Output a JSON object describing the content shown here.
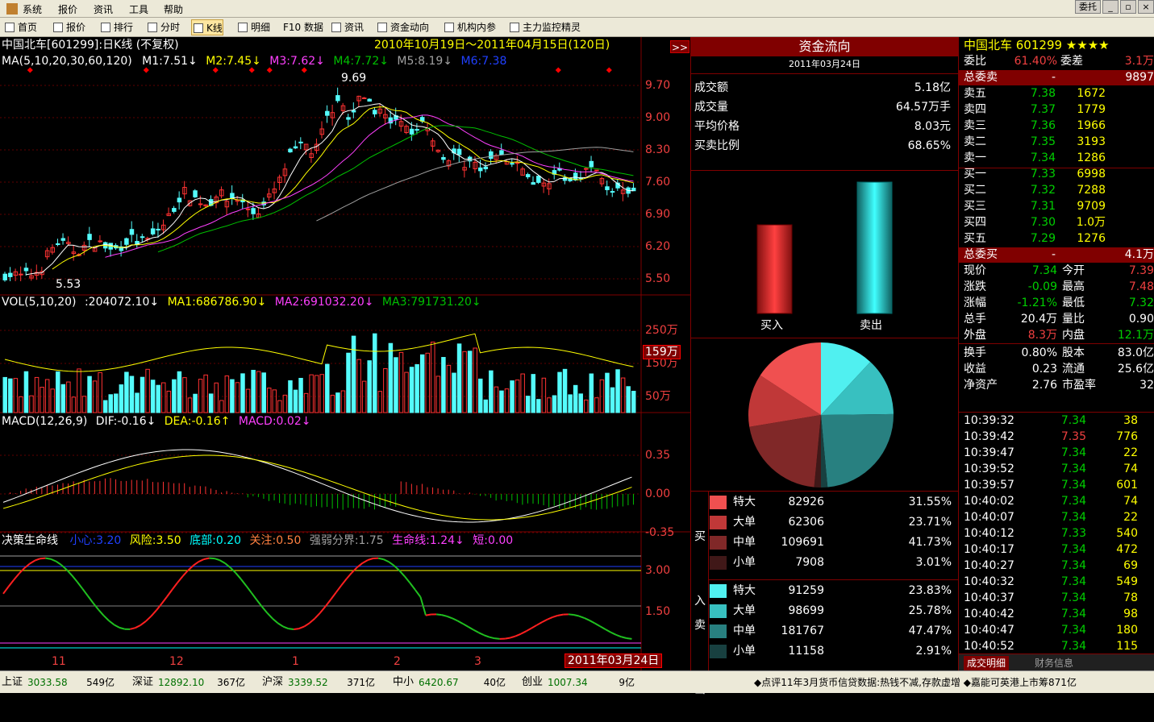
{
  "menu": [
    "系统",
    "报价",
    "资讯",
    "工具",
    "帮助"
  ],
  "window": {
    "right_tab": "委托"
  },
  "toolbar": [
    {
      "label": "首页"
    },
    {
      "label": "报价"
    },
    {
      "label": "排行"
    },
    {
      "label": "分时"
    },
    {
      "label": "K线"
    },
    {
      "label": "明细"
    },
    {
      "label": "F10 数据"
    },
    {
      "label": "资讯"
    },
    {
      "label": "资金动向"
    },
    {
      "label": "机构内参"
    },
    {
      "label": "主力监控精灵"
    }
  ],
  "chart": {
    "title": "中国北车[601299]:日K线",
    "adjust": "(不复权)",
    "date_range": "2010年10月19日～2011年04月15日(120日)",
    "expand_btn": ">>",
    "ma": {
      "label": "MA(5,10,20,30,60,120)",
      "m1": "M1:7.51↓",
      "m2": "M2:7.45↓",
      "m3": "M3:7.62↓",
      "m4": "M4:7.72↓",
      "m5": "M5:8.19↓",
      "m6": "M6:7.38"
    },
    "price_axis": [
      "9.70",
      "9.00",
      "8.30",
      "7.60",
      "6.90",
      "6.20",
      "5.50"
    ],
    "high_label": "9.69",
    "low_label": "5.53",
    "vol": {
      "label": "VOL(5,10,20)",
      "v": ":204072.10↓",
      "ma1": "MA1:686786.90↓",
      "ma2": "MA2:691032.20↓",
      "ma3": "MA3:791731.20↓"
    },
    "vol_axis": [
      "250万",
      "150万",
      "50万"
    ],
    "vol_marker": "159万",
    "macd": {
      "label": "MACD(12,26,9)",
      "dif": "DIF:-0.16↓",
      "dea": "DEA:-0.16↑",
      "macd": "MACD:0.02↓"
    },
    "macd_axis": [
      "0.35",
      "0.00",
      "-0.35"
    ],
    "jc": {
      "label": "决策生命线",
      "xin": "小心:3.20",
      "fx": "风险:3.50",
      "db": "底部:0.20",
      "gz": "关注:0.50",
      "qr": "强弱分界:1.75",
      "smx": "生命线:1.24↓",
      "duan": "短:0.00"
    },
    "jc_axis": [
      "3.00",
      "1.50"
    ],
    "x_labels": [
      "11",
      "12",
      "1",
      "2",
      "3"
    ],
    "cursor_date": "2011年03月24日"
  },
  "fund": {
    "title": "资金流向",
    "date": "2011年03月24日",
    "rows": [
      {
        "k": "成交额",
        "v": "5.18亿"
      },
      {
        "k": "成交量",
        "v": "64.57万手"
      },
      {
        "k": "平均价格",
        "v": "8.03元"
      },
      {
        "k": "买卖比例",
        "v": "68.65%"
      }
    ],
    "buy_label": "买入",
    "sell_label": "卖出",
    "buy_side": "买入",
    "sell_side": "卖出",
    "buy_rows": [
      {
        "k": "特大",
        "n": "82926",
        "p": "31.55%",
        "c": "#f05050"
      },
      {
        "k": "大单",
        "n": "62306",
        "p": "23.71%",
        "c": "#c03838"
      },
      {
        "k": "中单",
        "n": "109691",
        "p": "41.73%",
        "c": "#802828"
      },
      {
        "k": "小单",
        "n": "7908",
        "p": "3.01%",
        "c": "#401818"
      }
    ],
    "sell_rows": [
      {
        "k": "特大",
        "n": "91259",
        "p": "23.83%",
        "c": "#50f0f0"
      },
      {
        "k": "大单",
        "n": "98699",
        "p": "25.78%",
        "c": "#38c0c0"
      },
      {
        "k": "中单",
        "n": "181767",
        "p": "47.47%",
        "c": "#288080"
      },
      {
        "k": "小单",
        "n": "11158",
        "p": "2.91%",
        "c": "#184040"
      }
    ]
  },
  "quote": {
    "name": "中国北车 601299",
    "stars": "★★★★",
    "wb": "委比",
    "wb_v": "61.40%",
    "wc": "委差",
    "wc_v": "3.1万",
    "zwm": "总委卖",
    "zwm_v": "-",
    "zwm_n": "9897",
    "asks": [
      {
        "k": "卖五",
        "p": "7.38",
        "n": "1672"
      },
      {
        "k": "卖四",
        "p": "7.37",
        "n": "1779"
      },
      {
        "k": "卖三",
        "p": "7.36",
        "n": "1966"
      },
      {
        "k": "卖二",
        "p": "7.35",
        "n": "3193"
      },
      {
        "k": "卖一",
        "p": "7.34",
        "n": "1286"
      }
    ],
    "bids": [
      {
        "k": "买一",
        "p": "7.33",
        "n": "6998"
      },
      {
        "k": "买二",
        "p": "7.32",
        "n": "7288"
      },
      {
        "k": "买三",
        "p": "7.31",
        "n": "9709"
      },
      {
        "k": "买四",
        "p": "7.30",
        "n": "1.0万"
      },
      {
        "k": "买五",
        "p": "7.29",
        "n": "1276"
      }
    ],
    "zwb": "总委买",
    "zwb_v": "-",
    "zwb_n": "4.1万",
    "stats": [
      {
        "a": "现价",
        "av": "7.34",
        "b": "今开",
        "bv": "7.39",
        "ac": "#00d000",
        "bc": "#f04040"
      },
      {
        "a": "涨跌",
        "av": "-0.09",
        "b": "最高",
        "bv": "7.48",
        "ac": "#00d000",
        "bc": "#f04040"
      },
      {
        "a": "涨幅",
        "av": "-1.21%",
        "b": "最低",
        "bv": "7.32",
        "ac": "#00d000",
        "bc": "#00d000"
      },
      {
        "a": "总手",
        "av": "20.4万",
        "b": "量比",
        "bv": "0.90",
        "ac": "#fff",
        "bc": "#fff"
      },
      {
        "a": "外盘",
        "av": "8.3万",
        "b": "内盘",
        "bv": "12.1万",
        "ac": "#f04040",
        "bc": "#00d000"
      }
    ],
    "stats2": [
      {
        "a": "换手",
        "av": "0.80%",
        "b": "股本",
        "bv": "83.0亿"
      },
      {
        "a": "收益",
        "av": "0.23",
        "b": "流通",
        "bv": "25.6亿"
      },
      {
        "a": "净资产",
        "av": "2.76",
        "b": "市盈率",
        "bv": "32"
      }
    ],
    "ticks": [
      [
        "10:39:32",
        "7.34",
        "38"
      ],
      [
        "10:39:42",
        "7.35",
        "776"
      ],
      [
        "10:39:47",
        "7.34",
        "22"
      ],
      [
        "10:39:52",
        "7.34",
        "74"
      ],
      [
        "10:39:57",
        "7.34",
        "601"
      ],
      [
        "10:40:02",
        "7.34",
        "74"
      ],
      [
        "10:40:07",
        "7.34",
        "22"
      ],
      [
        "10:40:12",
        "7.33",
        "540"
      ],
      [
        "10:40:17",
        "7.34",
        "472"
      ],
      [
        "10:40:27",
        "7.34",
        "69"
      ],
      [
        "10:40:32",
        "7.34",
        "549"
      ],
      [
        "10:40:37",
        "7.34",
        "78"
      ],
      [
        "10:40:42",
        "7.34",
        "98"
      ],
      [
        "10:40:47",
        "7.34",
        "180"
      ],
      [
        "10:40:52",
        "7.34",
        "115"
      ]
    ],
    "tab1": "成交明细",
    "tab2": "财务信息"
  },
  "status": {
    "items": [
      {
        "n": "上证",
        "v": "3033.58",
        "a": "549亿"
      },
      {
        "n": "深证",
        "v": "12892.10",
        "a": "367亿"
      },
      {
        "n": "沪深",
        "v": "3339.52",
        "a": "371亿"
      },
      {
        "n": "中小",
        "v": "6420.67",
        "a": "40亿"
      },
      {
        "n": "创业",
        "v": "1007.34",
        "a": "9亿"
      }
    ],
    "news": "◆点评11年3月货币信贷数据:热钱不减,存款虚增 ◆嘉能可英港上市筹871亿"
  },
  "chart_data": {
    "type": "candlestick",
    "pie": {
      "buy": [
        31.55,
        23.71,
        41.73,
        3.01
      ],
      "sell": [
        23.83,
        25.78,
        47.47,
        2.91
      ]
    },
    "price_ylim": [
      5.2,
      10.0
    ],
    "vol_ylim": [
      0,
      300
    ],
    "macd_ylim": [
      -0.45,
      0.45
    ],
    "jc_ylim": [
      0,
      3.6
    ]
  }
}
